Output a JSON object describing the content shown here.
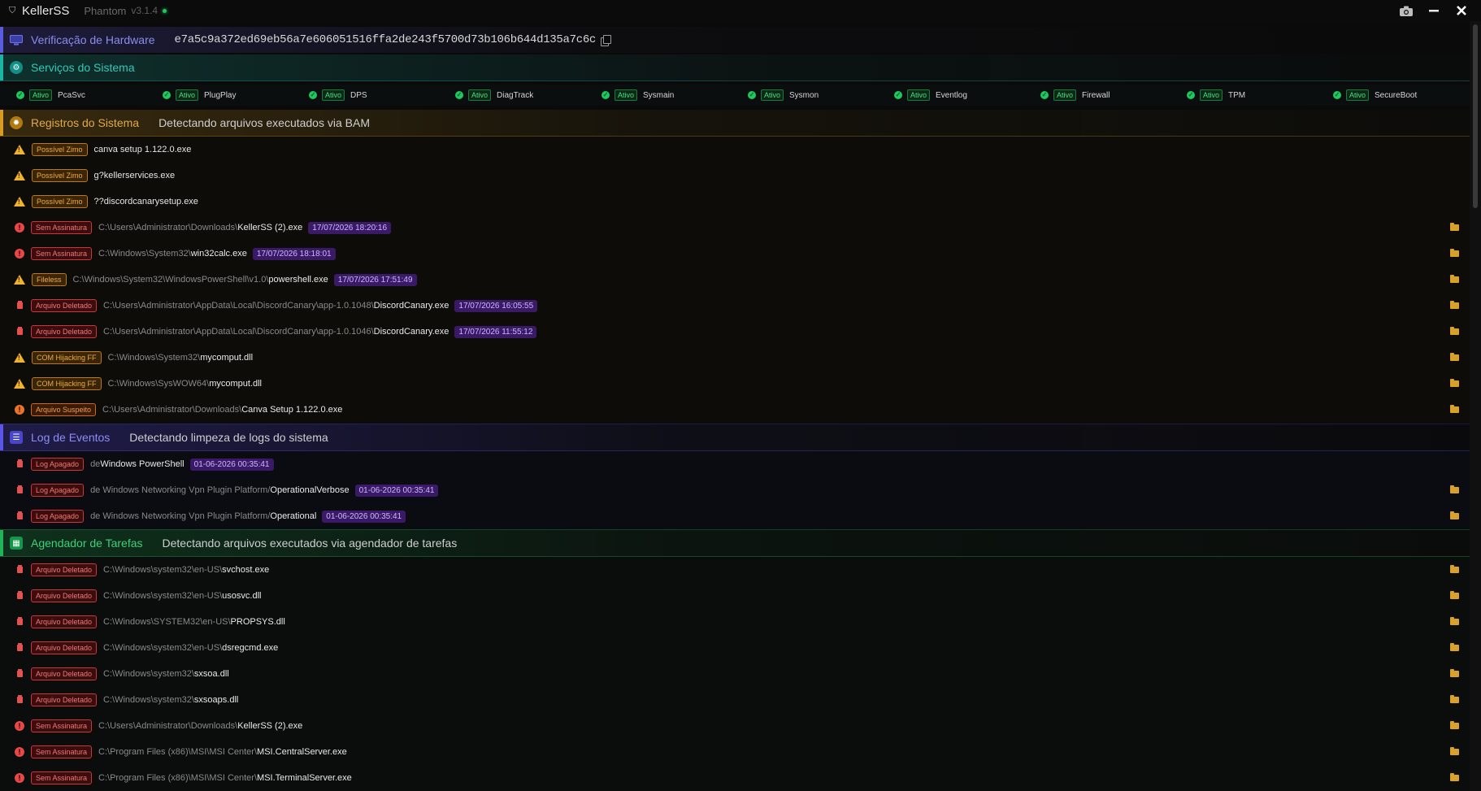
{
  "titlebar": {
    "app": "KellerSS",
    "subtitle": "Phantom",
    "version": "v3.1.4"
  },
  "hardware": {
    "title": "Verificação de Hardware",
    "hash": "e7a5c9a372ed69eb56a7e606051516ffa2de243f5700d73b106b644d135a7c6c"
  },
  "services": {
    "title": "Serviços do Sistema",
    "status_label": "Ativo",
    "items": [
      "PcaSvc",
      "PlugPlay",
      "DPS",
      "DiagTrack",
      "Sysmain",
      "Sysmon",
      "Eventlog",
      "Firewall",
      "TPM",
      "SecureBoot"
    ]
  },
  "registros": {
    "title": "Registros do Sistema",
    "desc": "Detectando arquivos executados via BAM",
    "rows": [
      {
        "badge": "Possível Zimo",
        "name": "canva setup 1.122.0.exe"
      },
      {
        "badge": "Possível Zimo",
        "name": "g?kellerservices.exe"
      },
      {
        "badge": "Possível Zimo",
        "name": "??discordcanarysetup.exe"
      },
      {
        "badge": "Sem Assinatura",
        "path": "C:\\Users\\Administrator\\Downloads\\",
        "file": "KellerSS (2).exe",
        "ts": "17/07/2026 18:20:16"
      },
      {
        "badge": "Sem Assinatura",
        "path": "C:\\Windows\\System32\\",
        "file": "win32calc.exe",
        "ts": "17/07/2026 18:18:01"
      },
      {
        "badge": "Fileless",
        "path": "C:\\Windows\\System32\\WindowsPowerShell\\v1.0\\",
        "file": "powershell.exe",
        "ts": "17/07/2026 17:51:49"
      },
      {
        "badge": "Arquivo Deletado",
        "path": "C:\\Users\\Administrator\\AppData\\Local\\DiscordCanary\\app-1.0.1048\\",
        "file": "DiscordCanary.exe",
        "ts": "17/07/2026 16:05:55"
      },
      {
        "badge": "Arquivo Deletado",
        "path": "C:\\Users\\Administrator\\AppData\\Local\\DiscordCanary\\app-1.0.1046\\",
        "file": "DiscordCanary.exe",
        "ts": "17/07/2026 11:55:12"
      },
      {
        "badge": "COM Hijacking FF",
        "path": "C:\\Windows\\System32\\",
        "file": "mycomput.dll"
      },
      {
        "badge": "COM Hijacking FF",
        "path": "C:\\Windows\\SysWOW64\\",
        "file": "mycomput.dll"
      },
      {
        "badge": "Arquivo Suspeito",
        "path": "C:\\Users\\Administrator\\Downloads\\",
        "file": "Canva Setup 1.122.0.exe"
      }
    ]
  },
  "logs": {
    "title": "Log de Eventos",
    "desc": "Detectando limpeza de logs do sistema",
    "rows": [
      {
        "badge": "Log Apagado",
        "prefix": "de ",
        "name": "Windows PowerShell",
        "ts": "01-06-2026 00:35:41"
      },
      {
        "badge": "Log Apagado",
        "prefix": "de Windows Networking Vpn Plugin Platform/",
        "name": "OperationalVerbose",
        "ts": "01-06-2026 00:35:41"
      },
      {
        "badge": "Log Apagado",
        "prefix": "de Windows Networking Vpn Plugin Platform/",
        "name": "Operational",
        "ts": "01-06-2026 00:35:41"
      }
    ]
  },
  "tarefas": {
    "title": "Agendador de Tarefas",
    "desc": "Detectando arquivos executados via agendador de tarefas",
    "rows": [
      {
        "badge": "Arquivo Deletado",
        "path": "C:\\Windows\\system32\\en-US\\",
        "file": "svchost.exe"
      },
      {
        "badge": "Arquivo Deletado",
        "path": "C:\\Windows\\system32\\en-US\\",
        "file": "usosvc.dll"
      },
      {
        "badge": "Arquivo Deletado",
        "path": "C:\\Windows\\SYSTEM32\\en-US\\",
        "file": "PROPSYS.dll"
      },
      {
        "badge": "Arquivo Deletado",
        "path": "C:\\Windows\\system32\\en-US\\",
        "file": "dsregcmd.exe"
      },
      {
        "badge": "Arquivo Deletado",
        "path": "C:\\Windows\\system32\\",
        "file": "sxsoa.dll"
      },
      {
        "badge": "Arquivo Deletado",
        "path": "C:\\Windows\\system32\\",
        "file": "sxsoaps.dll"
      },
      {
        "badge": "Sem Assinatura",
        "path": "C:\\Users\\Administrator\\Downloads\\",
        "file": "KellerSS (2).exe"
      },
      {
        "badge": "Sem Assinatura",
        "path": "C:\\Program Files (x86)\\MSI\\MSI Center\\",
        "file": "MSI.CentralServer.exe"
      },
      {
        "badge": "Sem Assinatura",
        "path": "C:\\Program Files (x86)\\MSI\\MSI Center\\",
        "file": "MSI.TerminalServer.exe"
      }
    ]
  },
  "icons": {
    "camera": "camera-icon",
    "minimize": "minimize-icon",
    "close": "close-icon"
  }
}
